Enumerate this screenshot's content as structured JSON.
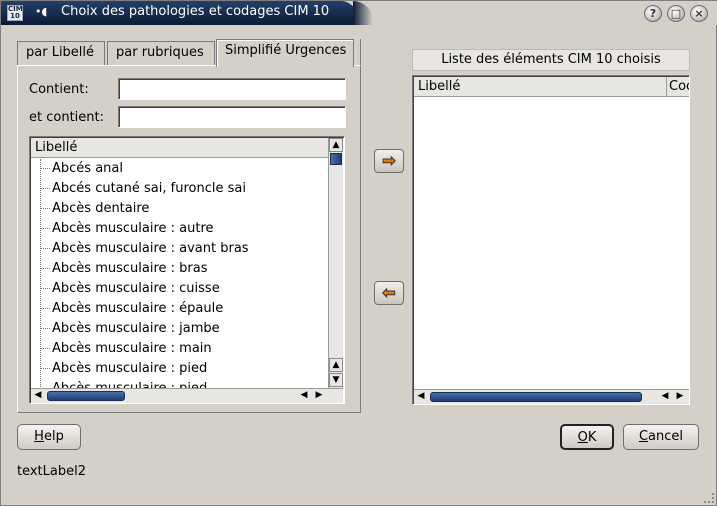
{
  "window": {
    "title": "Choix des pathologies et codages CIM 10",
    "app_icon_text": "CIM 10",
    "pin_icon": "pin-icon",
    "help_glyph": "?",
    "maximize_glyph": "□",
    "close_glyph": "×"
  },
  "tabs": [
    {
      "label": "par Libellé",
      "active": false
    },
    {
      "label": "par rubriques",
      "active": false
    },
    {
      "label": "Simplifié Urgences",
      "active": true
    }
  ],
  "filters": {
    "contains_label": "Contient:",
    "contains_value": "",
    "and_contains_label": "et contient:",
    "and_contains_value": ""
  },
  "left_list": {
    "header": "Libellé",
    "items": [
      "Abcés anal",
      "Abcés cutané sai, furoncle sai",
      "Abcès dentaire",
      "Abcès musculaire : autre",
      "Abcès musculaire : avant bras",
      "Abcès musculaire : bras",
      "Abcès musculaire : cuisse",
      "Abcès musculaire : épaule",
      "Abcès musculaire : jambe",
      "Abcès musculaire : main",
      "Abcès musculaire : pied",
      "Abcès musculaire : pied"
    ]
  },
  "right_list": {
    "title": "Liste des éléments CIM 10 choisis",
    "col_label": "Libellé",
    "col_code": "Coc"
  },
  "transfer": {
    "add_icon": "arrow-right-icon",
    "remove_icon": "arrow-left-icon"
  },
  "buttons": {
    "help": "Help",
    "ok": "OK",
    "cancel": "Cancel"
  },
  "status": {
    "text": "textLabel2"
  },
  "colors": {
    "titlebar": "#0b1a33",
    "face": "#d4d0c8",
    "accent_arrow": "#e07b10",
    "scroll_thumb": "#1f3e74"
  }
}
